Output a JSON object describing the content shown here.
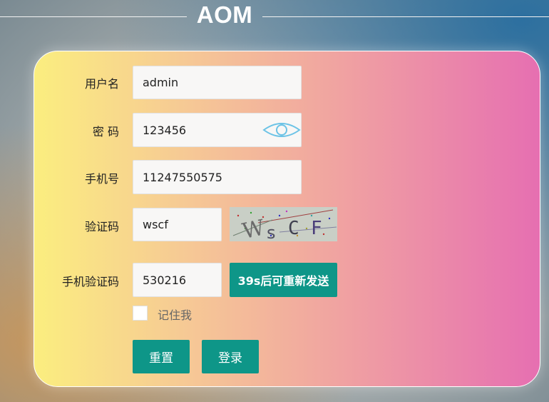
{
  "header": {
    "title": "AOM"
  },
  "form": {
    "username": {
      "label": "用户名",
      "value": "admin"
    },
    "password": {
      "label": "密 码",
      "value": "123456",
      "toggle_icon": "eye-icon"
    },
    "phone": {
      "label": "手机号",
      "value": "11247550575"
    },
    "captcha": {
      "label": "验证码",
      "value": "wscf",
      "image_text": "WsCF"
    },
    "sms_code": {
      "label": "手机验证码",
      "value": "530216",
      "resend_label": "39s后可重新发送"
    },
    "remember": {
      "label": "记住我",
      "checked": false
    },
    "reset_label": "重置",
    "login_label": "登录"
  },
  "colors": {
    "accent": "#0e9688",
    "card_gradient": [
      "#fbee7f",
      "#f6c995",
      "#f0a3a1",
      "#e66fb1"
    ],
    "eye_icon": "#6cc3e6"
  }
}
